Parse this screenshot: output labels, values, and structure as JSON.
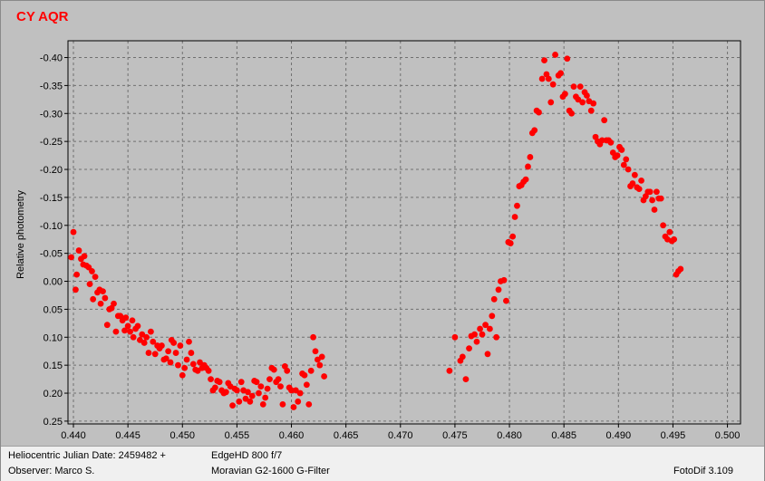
{
  "chart_data": {
    "type": "scatter",
    "title": "CY AQR",
    "xlabel": "",
    "ylabel": "Relative photometry",
    "xlim": [
      0.4395,
      0.5012
    ],
    "ylim": [
      0.255,
      -0.43
    ],
    "y_inverted": true,
    "grid": true,
    "marker_color": "#ff0000",
    "x_ticks": [
      "0.440",
      "0.445",
      "0.450",
      "0.455",
      "0.460",
      "0.465",
      "0.470",
      "0.475",
      "0.480",
      "0.485",
      "0.490",
      "0.495",
      "0.500"
    ],
    "y_ticks": [
      "-0.40",
      "-0.35",
      "-0.30",
      "-0.25",
      "-0.20",
      "-0.15",
      "-0.10",
      "-0.05",
      "0.00",
      "0.05",
      "0.10",
      "0.15",
      "0.20",
      "0.25"
    ],
    "x_tick_values": [
      0.44,
      0.445,
      0.45,
      0.455,
      0.46,
      0.465,
      0.47,
      0.475,
      0.48,
      0.485,
      0.49,
      0.495,
      0.5
    ],
    "y_tick_values": [
      -0.4,
      -0.35,
      -0.3,
      -0.25,
      -0.2,
      -0.15,
      -0.1,
      -0.05,
      0.0,
      0.05,
      0.1,
      0.15,
      0.2,
      0.25
    ],
    "points": [
      [
        0.4398,
        -0.043
      ],
      [
        0.44,
        -0.088
      ],
      [
        0.4402,
        0.015
      ],
      [
        0.4403,
        -0.012
      ],
      [
        0.4405,
        -0.055
      ],
      [
        0.4407,
        -0.04
      ],
      [
        0.4409,
        -0.03
      ],
      [
        0.441,
        -0.045
      ],
      [
        0.4412,
        -0.028
      ],
      [
        0.4414,
        -0.025
      ],
      [
        0.4415,
        0.005
      ],
      [
        0.4417,
        -0.018
      ],
      [
        0.4418,
        0.032
      ],
      [
        0.442,
        -0.008
      ],
      [
        0.4422,
        0.02
      ],
      [
        0.4424,
        0.015
      ],
      [
        0.4425,
        0.04
      ],
      [
        0.4427,
        0.018
      ],
      [
        0.4429,
        0.03
      ],
      [
        0.4431,
        0.078
      ],
      [
        0.4433,
        0.05
      ],
      [
        0.4435,
        0.048
      ],
      [
        0.4437,
        0.04
      ],
      [
        0.4439,
        0.09
      ],
      [
        0.4441,
        0.062
      ],
      [
        0.4443,
        0.062
      ],
      [
        0.4445,
        0.07
      ],
      [
        0.4447,
        0.088
      ],
      [
        0.4448,
        0.065
      ],
      [
        0.445,
        0.08
      ],
      [
        0.4452,
        0.09
      ],
      [
        0.4454,
        0.07
      ],
      [
        0.4455,
        0.1
      ],
      [
        0.4457,
        0.085
      ],
      [
        0.4459,
        0.08
      ],
      [
        0.4461,
        0.105
      ],
      [
        0.4463,
        0.095
      ],
      [
        0.4465,
        0.11
      ],
      [
        0.4467,
        0.1
      ],
      [
        0.4469,
        0.128
      ],
      [
        0.4471,
        0.09
      ],
      [
        0.4473,
        0.108
      ],
      [
        0.4475,
        0.13
      ],
      [
        0.4477,
        0.115
      ],
      [
        0.4479,
        0.12
      ],
      [
        0.4481,
        0.115
      ],
      [
        0.4483,
        0.14
      ],
      [
        0.4485,
        0.138
      ],
      [
        0.4487,
        0.125
      ],
      [
        0.4489,
        0.145
      ],
      [
        0.449,
        0.105
      ],
      [
        0.4492,
        0.11
      ],
      [
        0.4494,
        0.128
      ],
      [
        0.4496,
        0.15
      ],
      [
        0.4498,
        0.115
      ],
      [
        0.45,
        0.168
      ],
      [
        0.4502,
        0.155
      ],
      [
        0.4504,
        0.14
      ],
      [
        0.4506,
        0.108
      ],
      [
        0.4508,
        0.128
      ],
      [
        0.451,
        0.148
      ],
      [
        0.4512,
        0.158
      ],
      [
        0.4514,
        0.16
      ],
      [
        0.4516,
        0.145
      ],
      [
        0.4518,
        0.155
      ],
      [
        0.452,
        0.15
      ],
      [
        0.4522,
        0.155
      ],
      [
        0.4524,
        0.16
      ],
      [
        0.4526,
        0.175
      ],
      [
        0.4528,
        0.195
      ],
      [
        0.453,
        0.19
      ],
      [
        0.4532,
        0.178
      ],
      [
        0.4534,
        0.18
      ],
      [
        0.4536,
        0.195
      ],
      [
        0.4538,
        0.2
      ],
      [
        0.454,
        0.198
      ],
      [
        0.4542,
        0.182
      ],
      [
        0.4544,
        0.188
      ],
      [
        0.4546,
        0.222
      ],
      [
        0.4548,
        0.192
      ],
      [
        0.455,
        0.195
      ],
      [
        0.4552,
        0.215
      ],
      [
        0.4554,
        0.18
      ],
      [
        0.4556,
        0.195
      ],
      [
        0.4558,
        0.21
      ],
      [
        0.456,
        0.198
      ],
      [
        0.4562,
        0.215
      ],
      [
        0.4564,
        0.205
      ],
      [
        0.4566,
        0.178
      ],
      [
        0.4568,
        0.18
      ],
      [
        0.457,
        0.2
      ],
      [
        0.4572,
        0.188
      ],
      [
        0.4574,
        0.22
      ],
      [
        0.4576,
        0.208
      ],
      [
        0.4578,
        0.192
      ],
      [
        0.458,
        0.175
      ],
      [
        0.4582,
        0.155
      ],
      [
        0.4584,
        0.158
      ],
      [
        0.4586,
        0.18
      ],
      [
        0.4588,
        0.175
      ],
      [
        0.459,
        0.188
      ],
      [
        0.4592,
        0.22
      ],
      [
        0.4594,
        0.152
      ],
      [
        0.4596,
        0.16
      ],
      [
        0.4598,
        0.19
      ],
      [
        0.46,
        0.195
      ],
      [
        0.4602,
        0.225
      ],
      [
        0.4604,
        0.195
      ],
      [
        0.4606,
        0.215
      ],
      [
        0.4608,
        0.2
      ],
      [
        0.461,
        0.165
      ],
      [
        0.4612,
        0.168
      ],
      [
        0.4614,
        0.185
      ],
      [
        0.4616,
        0.22
      ],
      [
        0.4618,
        0.16
      ],
      [
        0.462,
        0.1
      ],
      [
        0.4622,
        0.125
      ],
      [
        0.4624,
        0.14
      ],
      [
        0.4626,
        0.15
      ],
      [
        0.4628,
        0.135
      ],
      [
        0.463,
        0.17
      ]
    ],
    "points_b": [
      [
        0.4745,
        0.16
      ],
      [
        0.475,
        0.1
      ],
      [
        0.4755,
        0.142
      ],
      [
        0.4757,
        0.135
      ],
      [
        0.476,
        0.175
      ],
      [
        0.4763,
        0.12
      ],
      [
        0.4765,
        0.098
      ],
      [
        0.4768,
        0.095
      ],
      [
        0.477,
        0.108
      ],
      [
        0.4773,
        0.085
      ],
      [
        0.4775,
        0.095
      ],
      [
        0.4778,
        0.078
      ],
      [
        0.478,
        0.13
      ],
      [
        0.4782,
        0.085
      ],
      [
        0.4784,
        0.062
      ],
      [
        0.4786,
        0.032
      ],
      [
        0.4788,
        0.1
      ],
      [
        0.479,
        0.015
      ],
      [
        0.4792,
        0.0
      ],
      [
        0.4795,
        -0.002
      ],
      [
        0.4797,
        0.035
      ],
      [
        0.4799,
        -0.07
      ],
      [
        0.4801,
        -0.068
      ],
      [
        0.4803,
        -0.08
      ],
      [
        0.4805,
        -0.115
      ],
      [
        0.4807,
        -0.135
      ],
      [
        0.4809,
        -0.17
      ],
      [
        0.4811,
        -0.172
      ],
      [
        0.4813,
        -0.178
      ],
      [
        0.4815,
        -0.182
      ],
      [
        0.4817,
        -0.205
      ],
      [
        0.4819,
        -0.222
      ],
      [
        0.4821,
        -0.265
      ],
      [
        0.4823,
        -0.27
      ],
      [
        0.4825,
        -0.305
      ],
      [
        0.4827,
        -0.302
      ],
      [
        0.483,
        -0.362
      ],
      [
        0.4832,
        -0.395
      ],
      [
        0.4834,
        -0.37
      ],
      [
        0.4836,
        -0.362
      ],
      [
        0.4838,
        -0.32
      ],
      [
        0.484,
        -0.352
      ],
      [
        0.4842,
        -0.405
      ],
      [
        0.4845,
        -0.368
      ],
      [
        0.4847,
        -0.372
      ],
      [
        0.4849,
        -0.33
      ],
      [
        0.4851,
        -0.335
      ],
      [
        0.4853,
        -0.398
      ],
      [
        0.4855,
        -0.305
      ],
      [
        0.4857,
        -0.3
      ],
      [
        0.4859,
        -0.348
      ],
      [
        0.4861,
        -0.33
      ],
      [
        0.4863,
        -0.325
      ],
      [
        0.4865,
        -0.348
      ],
      [
        0.4867,
        -0.32
      ],
      [
        0.4869,
        -0.338
      ],
      [
        0.4871,
        -0.332
      ],
      [
        0.4873,
        -0.322
      ],
      [
        0.4875,
        -0.305
      ],
      [
        0.4877,
        -0.318
      ],
      [
        0.4879,
        -0.258
      ],
      [
        0.4881,
        -0.25
      ],
      [
        0.4883,
        -0.245
      ],
      [
        0.4885,
        -0.252
      ],
      [
        0.4887,
        -0.288
      ],
      [
        0.4889,
        -0.252
      ],
      [
        0.4891,
        -0.252
      ],
      [
        0.4893,
        -0.248
      ],
      [
        0.4895,
        -0.23
      ],
      [
        0.4897,
        -0.222
      ],
      [
        0.4899,
        -0.225
      ],
      [
        0.4901,
        -0.24
      ],
      [
        0.4903,
        -0.235
      ],
      [
        0.4905,
        -0.208
      ],
      [
        0.4907,
        -0.218
      ],
      [
        0.4909,
        -0.2
      ],
      [
        0.4911,
        -0.17
      ],
      [
        0.4913,
        -0.175
      ],
      [
        0.4915,
        -0.19
      ],
      [
        0.4917,
        -0.168
      ],
      [
        0.4919,
        -0.165
      ],
      [
        0.4921,
        -0.18
      ],
      [
        0.4923,
        -0.145
      ],
      [
        0.4925,
        -0.152
      ],
      [
        0.4927,
        -0.16
      ],
      [
        0.4929,
        -0.16
      ],
      [
        0.4931,
        -0.145
      ],
      [
        0.4933,
        -0.128
      ],
      [
        0.4935,
        -0.16
      ],
      [
        0.4937,
        -0.148
      ],
      [
        0.4939,
        -0.148
      ],
      [
        0.4941,
        -0.1
      ],
      [
        0.4943,
        -0.08
      ],
      [
        0.4945,
        -0.075
      ],
      [
        0.4947,
        -0.088
      ],
      [
        0.4949,
        -0.072
      ],
      [
        0.4951,
        -0.075
      ],
      [
        0.4953,
        -0.012
      ],
      [
        0.4955,
        -0.018
      ],
      [
        0.4957,
        -0.022
      ]
    ]
  },
  "footer": {
    "julian_date": "Heliocentric Julian Date: 2459482 +",
    "observer": "Observer: Marco S.",
    "telescope": "EdgeHD 800 f/7",
    "camera_filter": "Moravian G2-1600  G-Filter",
    "software": "FotoDif 3.109"
  }
}
